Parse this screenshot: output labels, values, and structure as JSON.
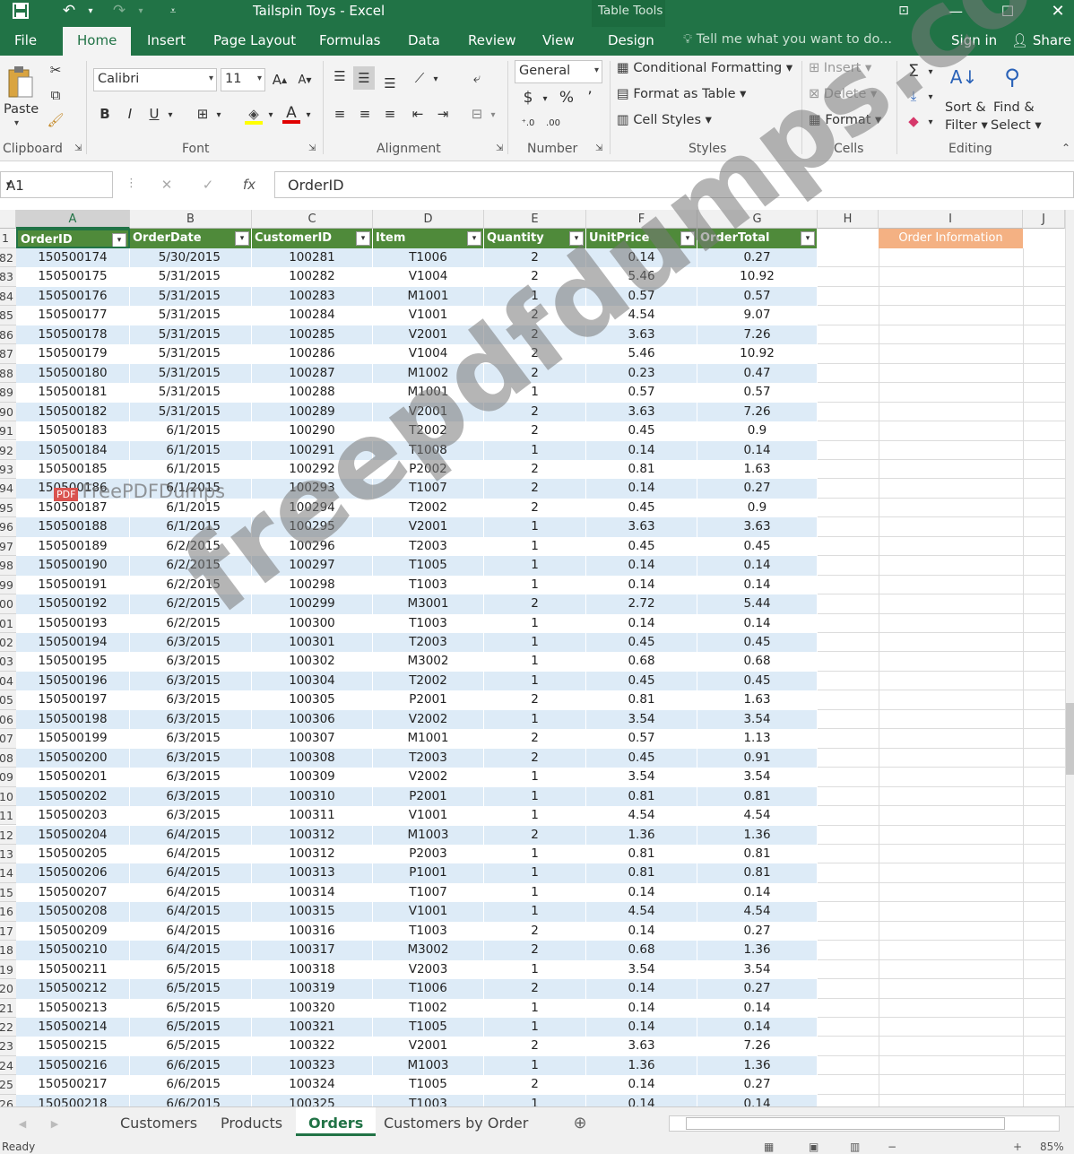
{
  "window": {
    "title": "Tailspin Toys - Excel",
    "context_tab": "Table Tools"
  },
  "tabs": [
    "File",
    "Home",
    "Insert",
    "Page Layout",
    "Formulas",
    "Data",
    "Review",
    "View",
    "Design"
  ],
  "tell_me": "Tell me what you want to do...",
  "sign_in": "Sign in",
  "share": "Share",
  "ribbon": {
    "paste": "Paste",
    "font_name": "Calibri",
    "font_size": "11",
    "number_format": "General",
    "conditional_formatting": "Conditional Formatting",
    "format_as_table": "Format as Table",
    "cell_styles": "Cell Styles",
    "insert": "Insert",
    "delete": "Delete",
    "format": "Format",
    "sort_filter_1": "Sort &",
    "sort_filter_2": "Filter",
    "find_select_1": "Find &",
    "find_select_2": "Select",
    "groups": {
      "clipboard": "Clipboard",
      "font": "Font",
      "alignment": "Alignment",
      "number": "Number",
      "styles": "Styles",
      "cells": "Cells",
      "editing": "Editing"
    }
  },
  "formula_bar": {
    "name_box": "A1",
    "formula": "OrderID"
  },
  "columns": [
    "A",
    "B",
    "C",
    "D",
    "E",
    "F",
    "G",
    "H",
    "I",
    "J"
  ],
  "table_headers": [
    "OrderID",
    "OrderDate",
    "CustomerID",
    "Item",
    "Quantity",
    "UnitPrice",
    "OrderTotal"
  ],
  "info_cell": "Order Information",
  "header_row_number": "1",
  "rows": [
    [
      "82",
      "150500174",
      "5/30/2015",
      "100281",
      "T1006",
      "2",
      "0.14",
      "0.27"
    ],
    [
      "83",
      "150500175",
      "5/31/2015",
      "100282",
      "V1004",
      "2",
      "5.46",
      "10.92"
    ],
    [
      "84",
      "150500176",
      "5/31/2015",
      "100283",
      "M1001",
      "1",
      "0.57",
      "0.57"
    ],
    [
      "85",
      "150500177",
      "5/31/2015",
      "100284",
      "V1001",
      "2",
      "4.54",
      "9.07"
    ],
    [
      "86",
      "150500178",
      "5/31/2015",
      "100285",
      "V2001",
      "2",
      "3.63",
      "7.26"
    ],
    [
      "87",
      "150500179",
      "5/31/2015",
      "100286",
      "V1004",
      "2",
      "5.46",
      "10.92"
    ],
    [
      "88",
      "150500180",
      "5/31/2015",
      "100287",
      "M1002",
      "2",
      "0.23",
      "0.47"
    ],
    [
      "89",
      "150500181",
      "5/31/2015",
      "100288",
      "M1001",
      "1",
      "0.57",
      "0.57"
    ],
    [
      "90",
      "150500182",
      "5/31/2015",
      "100289",
      "V2001",
      "2",
      "3.63",
      "7.26"
    ],
    [
      "91",
      "150500183",
      "6/1/2015",
      "100290",
      "T2002",
      "2",
      "0.45",
      "0.9"
    ],
    [
      "92",
      "150500184",
      "6/1/2015",
      "100291",
      "T1008",
      "1",
      "0.14",
      "0.14"
    ],
    [
      "93",
      "150500185",
      "6/1/2015",
      "100292",
      "P2002",
      "2",
      "0.81",
      "1.63"
    ],
    [
      "94",
      "150500186",
      "6/1/2015",
      "100293",
      "T1007",
      "2",
      "0.14",
      "0.27"
    ],
    [
      "95",
      "150500187",
      "6/1/2015",
      "100294",
      "T2002",
      "2",
      "0.45",
      "0.9"
    ],
    [
      "96",
      "150500188",
      "6/1/2015",
      "100295",
      "V2001",
      "1",
      "3.63",
      "3.63"
    ],
    [
      "97",
      "150500189",
      "6/2/2015",
      "100296",
      "T2003",
      "1",
      "0.45",
      "0.45"
    ],
    [
      "98",
      "150500190",
      "6/2/2015",
      "100297",
      "T1005",
      "1",
      "0.14",
      "0.14"
    ],
    [
      "99",
      "150500191",
      "6/2/2015",
      "100298",
      "T1003",
      "1",
      "0.14",
      "0.14"
    ],
    [
      "00",
      "150500192",
      "6/2/2015",
      "100299",
      "M3001",
      "2",
      "2.72",
      "5.44"
    ],
    [
      "01",
      "150500193",
      "6/2/2015",
      "100300",
      "T1003",
      "1",
      "0.14",
      "0.14"
    ],
    [
      "02",
      "150500194",
      "6/3/2015",
      "100301",
      "T2003",
      "1",
      "0.45",
      "0.45"
    ],
    [
      "03",
      "150500195",
      "6/3/2015",
      "100302",
      "M3002",
      "1",
      "0.68",
      "0.68"
    ],
    [
      "04",
      "150500196",
      "6/3/2015",
      "100304",
      "T2002",
      "1",
      "0.45",
      "0.45"
    ],
    [
      "05",
      "150500197",
      "6/3/2015",
      "100305",
      "P2001",
      "2",
      "0.81",
      "1.63"
    ],
    [
      "06",
      "150500198",
      "6/3/2015",
      "100306",
      "V2002",
      "1",
      "3.54",
      "3.54"
    ],
    [
      "07",
      "150500199",
      "6/3/2015",
      "100307",
      "M1001",
      "2",
      "0.57",
      "1.13"
    ],
    [
      "08",
      "150500200",
      "6/3/2015",
      "100308",
      "T2003",
      "2",
      "0.45",
      "0.91"
    ],
    [
      "09",
      "150500201",
      "6/3/2015",
      "100309",
      "V2002",
      "1",
      "3.54",
      "3.54"
    ],
    [
      "10",
      "150500202",
      "6/3/2015",
      "100310",
      "P2001",
      "1",
      "0.81",
      "0.81"
    ],
    [
      "11",
      "150500203",
      "6/3/2015",
      "100311",
      "V1001",
      "1",
      "4.54",
      "4.54"
    ],
    [
      "12",
      "150500204",
      "6/4/2015",
      "100312",
      "M1003",
      "2",
      "1.36",
      "1.36"
    ],
    [
      "13",
      "150500205",
      "6/4/2015",
      "100312",
      "P2003",
      "1",
      "0.81",
      "0.81"
    ],
    [
      "14",
      "150500206",
      "6/4/2015",
      "100313",
      "P1001",
      "1",
      "0.81",
      "0.81"
    ],
    [
      "15",
      "150500207",
      "6/4/2015",
      "100314",
      "T1007",
      "1",
      "0.14",
      "0.14"
    ],
    [
      "16",
      "150500208",
      "6/4/2015",
      "100315",
      "V1001",
      "1",
      "4.54",
      "4.54"
    ],
    [
      "17",
      "150500209",
      "6/4/2015",
      "100316",
      "T1003",
      "2",
      "0.14",
      "0.27"
    ],
    [
      "18",
      "150500210",
      "6/4/2015",
      "100317",
      "M3002",
      "2",
      "0.68",
      "1.36"
    ],
    [
      "19",
      "150500211",
      "6/5/2015",
      "100318",
      "V2003",
      "1",
      "3.54",
      "3.54"
    ],
    [
      "20",
      "150500212",
      "6/5/2015",
      "100319",
      "T1006",
      "2",
      "0.14",
      "0.27"
    ],
    [
      "21",
      "150500213",
      "6/5/2015",
      "100320",
      "T1002",
      "1",
      "0.14",
      "0.14"
    ],
    [
      "22",
      "150500214",
      "6/5/2015",
      "100321",
      "T1005",
      "1",
      "0.14",
      "0.14"
    ],
    [
      "23",
      "150500215",
      "6/5/2015",
      "100322",
      "V2001",
      "2",
      "3.63",
      "7.26"
    ],
    [
      "24",
      "150500216",
      "6/6/2015",
      "100323",
      "M1003",
      "1",
      "1.36",
      "1.36"
    ],
    [
      "25",
      "150500217",
      "6/6/2015",
      "100324",
      "T1005",
      "2",
      "0.14",
      "0.27"
    ],
    [
      "26",
      "150500218",
      "6/6/2015",
      "100325",
      "T1003",
      "1",
      "0.14",
      "0.14"
    ]
  ],
  "sheets": [
    "Customers",
    "Products",
    "Orders",
    "Customers by Order"
  ],
  "active_sheet": "Orders",
  "status": {
    "ready": "Ready",
    "zoom": "85%"
  },
  "watermark": {
    "main": "freepdfdumps.com",
    "logo_text": "FreePDFDumps",
    "logo_badge": "PDF"
  },
  "colors": {
    "accent": "#217346",
    "table_header": "#4f8a3a",
    "band": "#ddebf7",
    "info": "#f4b183"
  }
}
